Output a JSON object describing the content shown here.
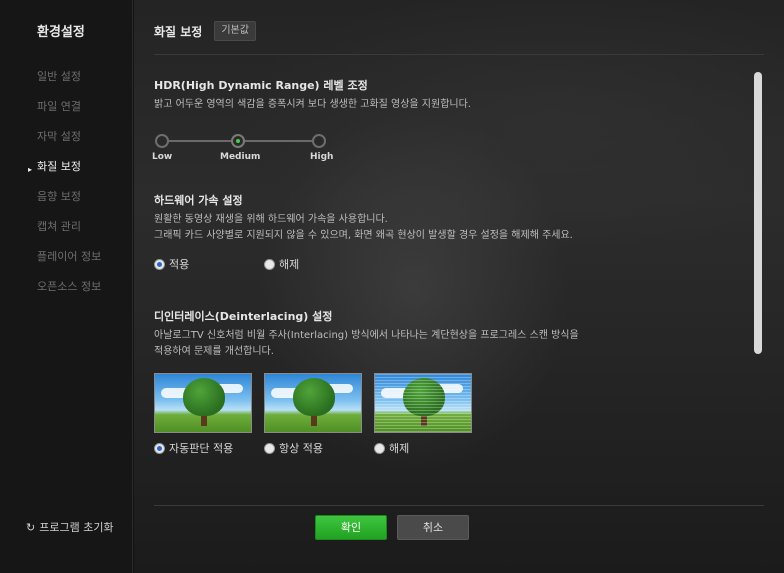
{
  "sidebar": {
    "title": "환경설정",
    "items": [
      {
        "label": "일반 설정"
      },
      {
        "label": "파일 연결"
      },
      {
        "label": "자막 설정"
      },
      {
        "label": "화질 보정"
      },
      {
        "label": "음향 보정"
      },
      {
        "label": "캡쳐 관리"
      },
      {
        "label": "플레이어 정보"
      },
      {
        "label": "오픈소스 정보"
      }
    ],
    "active_arrow": "▸",
    "reset_icon": "↻",
    "reset_label": "프로그램 초기화"
  },
  "main": {
    "title": "화질 보정",
    "default_button": "기본값",
    "hdr": {
      "title": "HDR(High Dynamic Range) 레벨 조정",
      "desc": "밝고 어두운 영역의 색감을 증폭시켜 보다 생생한 고화질 영상을 지원합니다.",
      "levels": [
        "Low",
        "Medium",
        "High"
      ],
      "selected": "Medium"
    },
    "hw": {
      "title": "하드웨어 가속 설정",
      "desc1": "원활한 동영상 재생을 위해 하드웨어 가속을 사용합니다.",
      "desc2": "그래픽 카드 사양별로 지원되지 않을 수 있으며, 화면 왜곡 현상이 발생할 경우 설정을 해제해 주세요.",
      "options": [
        "적용",
        "해제"
      ],
      "selected": "적용"
    },
    "deint": {
      "title": "디인터레이스(Deinterlacing) 설정",
      "desc1": "아날로그TV 신호처럼 비월 주사(Interlacing) 방식에서 나타나는 계단현상을 프로그레스 스캔 방식을",
      "desc2": "적용하여 문제를 개선합니다.",
      "options": [
        "자동판단 적용",
        "항상 적용",
        "해제"
      ],
      "selected": "자동판단 적용"
    },
    "ok_button": "확인",
    "cancel_button": "취소"
  },
  "colors": {
    "accent_green": "#2fb52f",
    "radio_selected": "#2b66c8"
  }
}
